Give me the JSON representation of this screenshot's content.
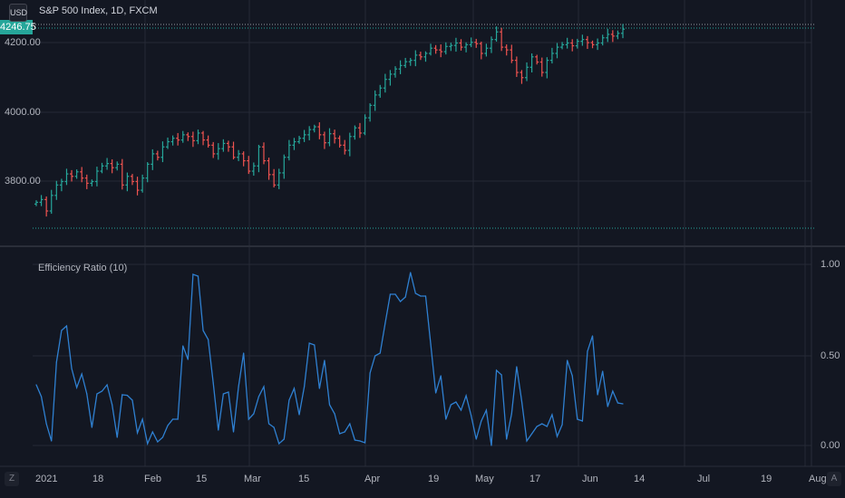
{
  "header": {
    "title": "S&P 500 Index, 1D, FXCM",
    "currency": "USD",
    "last_price": "4246.75"
  },
  "price_axis": {
    "labels": [
      "4200.00",
      "4000.00",
      "3800.00"
    ],
    "values": [
      4200,
      4000,
      3800
    ]
  },
  "indicator": {
    "title": "Efficiency Ratio (10)",
    "axis_labels": [
      "1.00",
      "0.50",
      "0.00"
    ],
    "axis_values": [
      1,
      0.5,
      0
    ]
  },
  "time_axis": {
    "labels": [
      "2021",
      "18",
      "Feb",
      "15",
      "Mar",
      "15",
      "Apr",
      "19",
      "May",
      "17",
      "Jun",
      "14",
      "Jul",
      "19",
      "Aug"
    ]
  },
  "controls": {
    "timezone_button": "Z",
    "auto_scale_button": "A"
  },
  "colors": {
    "up": "#26a69a",
    "down": "#ef5350",
    "line": "#2f80d1",
    "background": "#131722",
    "grid": "#262a36"
  },
  "chart_data": [
    {
      "type": "ohlc-bars",
      "title": "S&P 500 Index, 1D, FXCM",
      "ylim": [
        3680,
        4265
      ],
      "close": [
        3740,
        3748,
        3715,
        3760,
        3790,
        3800,
        3822,
        3815,
        3828,
        3810,
        3795,
        3800,
        3830,
        3845,
        3852,
        3840,
        3850,
        3790,
        3815,
        3800,
        3775,
        3810,
        3850,
        3880,
        3870,
        3900,
        3915,
        3925,
        3920,
        3935,
        3930,
        3918,
        3940,
        3920,
        3905,
        3880,
        3895,
        3910,
        3900,
        3870,
        3880,
        3860,
        3830,
        3845,
        3900,
        3860,
        3820,
        3790,
        3825,
        3870,
        3905,
        3915,
        3925,
        3935,
        3950,
        3958,
        3935,
        3912,
        3938,
        3925,
        3905,
        3890,
        3930,
        3955,
        3940,
        3984,
        4020,
        4050,
        4070,
        4095,
        4110,
        4125,
        4135,
        4146,
        4150,
        4165,
        4160,
        4170,
        4185,
        4180,
        4175,
        4190,
        4193,
        4200,
        4188,
        4195,
        4202,
        4198,
        4170,
        4185,
        4210,
        4232,
        4188,
        4180,
        4150,
        4115,
        4100,
        4130,
        4160,
        4145,
        4115,
        4150,
        4170,
        4188,
        4195,
        4200,
        4192,
        4205,
        4210,
        4201,
        4195,
        4200,
        4215,
        4225,
        4220,
        4228,
        4240
      ]
    },
    {
      "type": "line",
      "title": "Efficiency Ratio (10)",
      "ylim": [
        0,
        1
      ],
      "values": [
        0.335,
        0.27,
        0.12,
        0.025,
        0.46,
        0.635,
        0.66,
        0.425,
        0.32,
        0.395,
        0.285,
        0.1,
        0.285,
        0.3,
        0.335,
        0.225,
        0.045,
        0.28,
        0.277,
        0.25,
        0.07,
        0.145,
        0.01,
        0.075,
        0.02,
        0.045,
        0.11,
        0.145,
        0.145,
        0.55,
        0.475,
        0.945,
        0.935,
        0.635,
        0.585,
        0.345,
        0.085,
        0.285,
        0.295,
        0.075,
        0.325,
        0.51,
        0.145,
        0.175,
        0.27,
        0.325,
        0.12,
        0.1,
        0.01,
        0.035,
        0.25,
        0.315,
        0.17,
        0.325,
        0.565,
        0.555,
        0.315,
        0.47,
        0.225,
        0.175,
        0.065,
        0.075,
        0.12,
        0.03,
        0.025,
        0.015,
        0.4,
        0.495,
        0.51,
        0.675,
        0.835,
        0.835,
        0.795,
        0.82,
        0.955,
        0.84,
        0.825,
        0.825,
        0.56,
        0.29,
        0.385,
        0.145,
        0.225,
        0.24,
        0.195,
        0.275,
        0.165,
        0.035,
        0.135,
        0.195,
        0.0,
        0.415,
        0.39,
        0.035,
        0.175,
        0.435,
        0.245,
        0.025,
        0.065,
        0.105,
        0.12,
        0.105,
        0.17,
        0.05,
        0.115,
        0.47,
        0.385,
        0.145,
        0.135,
        0.52,
        0.605,
        0.28,
        0.41,
        0.215,
        0.3,
        0.235,
        0.23
      ]
    }
  ]
}
